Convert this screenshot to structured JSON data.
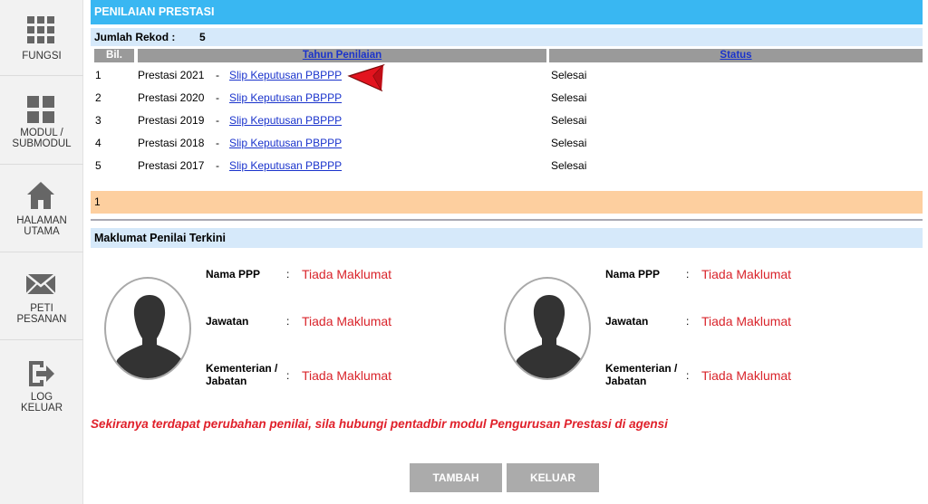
{
  "sidebar": {
    "items": [
      {
        "label": "FUNGSI",
        "icon": "grid-icon"
      },
      {
        "label": "MODUL /\nSUBMODUL",
        "icon": "modules-icon"
      },
      {
        "label": "HALAMAN\nUTAMA",
        "icon": "home-icon"
      },
      {
        "label": "PETI\nPESANAN",
        "icon": "mail-icon"
      },
      {
        "label": "LOG\nKELUAR",
        "icon": "logout-icon"
      }
    ]
  },
  "header": {
    "title": "PENILAIAN PRESTASI",
    "record_label": "Jumlah Rekod :",
    "record_count": "5"
  },
  "table": {
    "columns": [
      "Bil.",
      "Tahun Penilaian",
      "Status"
    ],
    "rows": [
      {
        "no": "1",
        "year": "Prestasi 2021",
        "sep": "-",
        "link": "Slip Keputusan PBPPP",
        "status": "Selesai"
      },
      {
        "no": "2",
        "year": "Prestasi 2020",
        "sep": "-",
        "link": "Slip Keputusan PBPPP",
        "status": "Selesai"
      },
      {
        "no": "3",
        "year": "Prestasi 2019",
        "sep": "-",
        "link": "Slip Keputusan PBPPP",
        "status": "Selesai"
      },
      {
        "no": "4",
        "year": "Prestasi 2018",
        "sep": "-",
        "link": "Slip Keputusan PBPPP",
        "status": "Selesai"
      },
      {
        "no": "5",
        "year": "Prestasi 2017",
        "sep": "-",
        "link": "Slip Keputusan PBPPP",
        "status": "Selesai"
      }
    ],
    "page": "1"
  },
  "assessor": {
    "section_title": "Maklumat Penilai Terkini",
    "colon": ":",
    "cards": [
      {
        "fields": [
          {
            "label": "Nama PPP",
            "value": "Tiada Maklumat"
          },
          {
            "label": "Jawatan",
            "value": "Tiada Maklumat"
          },
          {
            "label": "Kementerian /\nJabatan",
            "value": "Tiada Maklumat"
          }
        ]
      },
      {
        "fields": [
          {
            "label": "Nama PPP",
            "value": "Tiada Maklumat"
          },
          {
            "label": "Jawatan",
            "value": "Tiada Maklumat"
          },
          {
            "label": "Kementerian /\nJabatan",
            "value": "Tiada Maklumat"
          }
        ]
      }
    ]
  },
  "notice": "Sekiranya terdapat perubahan penilai, sila hubungi pentadbir modul Pengurusan Prestasi di agensi",
  "buttons": {
    "add": "TAMBAH",
    "exit": "KELUAR"
  },
  "colors": {
    "title_bar": "#39b7f2",
    "sub_bar": "#d6e9fa",
    "pager": "#fdcf9f",
    "value_red": "#d9242b",
    "link_blue": "#1a33cc",
    "arrow_red": "#e3141f"
  }
}
